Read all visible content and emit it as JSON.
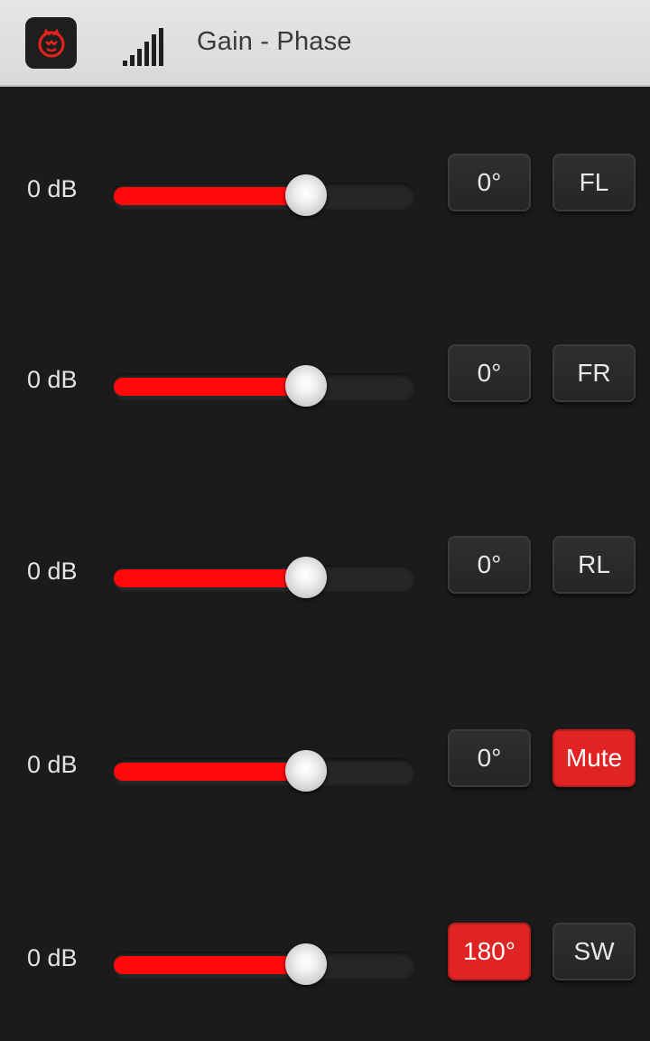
{
  "header": {
    "title": "Gain - Phase",
    "logo_icon": "cat-logo-icon",
    "signal_icon": "signal-strength-icon"
  },
  "colors": {
    "accent": "#ff0a0a",
    "active_button": "#e02424",
    "background": "#1b1b1c",
    "header_background": "#e0e0e0"
  },
  "channels": [
    {
      "gain": "0 dB",
      "level": 0.64,
      "phase": "0°",
      "phase_active": false,
      "channel": "FL",
      "channel_active": false
    },
    {
      "gain": "0 dB",
      "level": 0.64,
      "phase": "0°",
      "phase_active": false,
      "channel": "FR",
      "channel_active": false
    },
    {
      "gain": "0 dB",
      "level": 0.64,
      "phase": "0°",
      "phase_active": false,
      "channel": "RL",
      "channel_active": false
    },
    {
      "gain": "0 dB",
      "level": 0.64,
      "phase": "0°",
      "phase_active": false,
      "channel": "Mute",
      "channel_active": true
    },
    {
      "gain": "0 dB",
      "level": 0.64,
      "phase": "180°",
      "phase_active": true,
      "channel": "SW",
      "channel_active": false
    }
  ]
}
